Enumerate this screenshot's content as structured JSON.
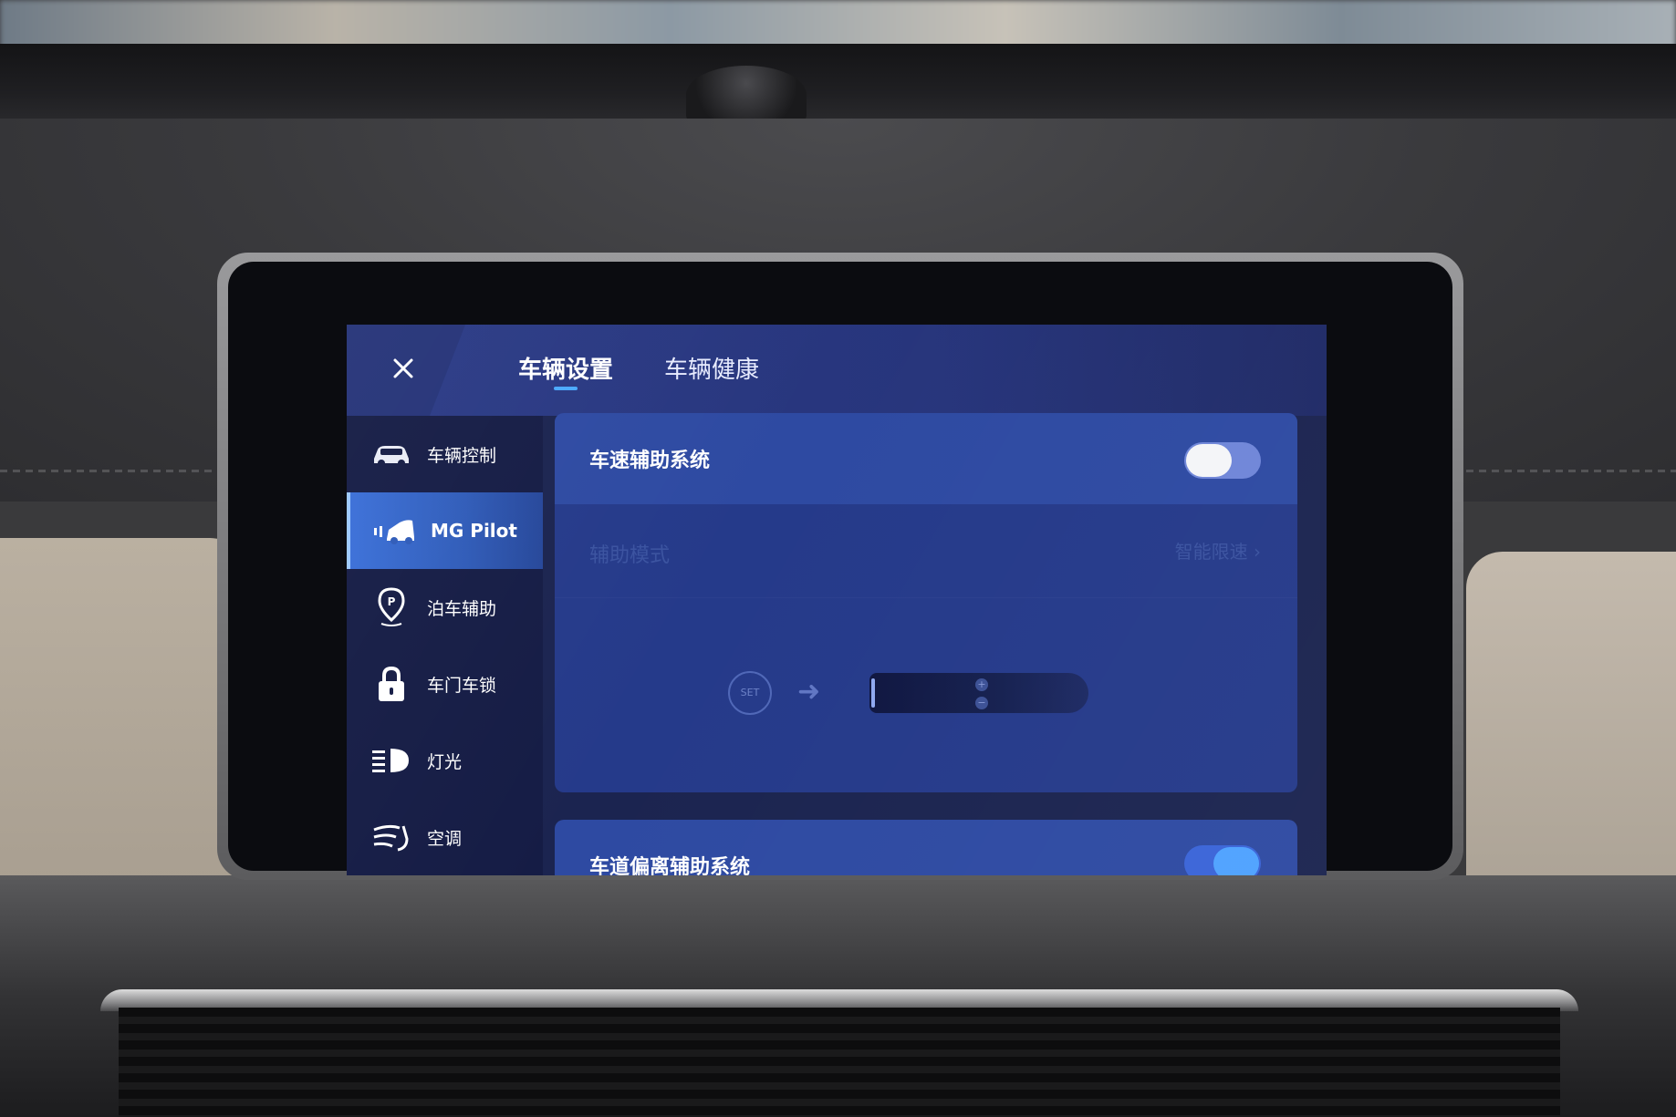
{
  "header": {
    "close_icon": "close-icon",
    "tabs": [
      {
        "label": "车辆设置",
        "active": true
      },
      {
        "label": "车辆健康",
        "active": false
      }
    ]
  },
  "sidebar": {
    "items": [
      {
        "label": "车辆控制",
        "icon": "car-icon",
        "active": false
      },
      {
        "label": "MG Pilot",
        "icon": "pilot-car-icon",
        "active": true
      },
      {
        "label": "泊车辅助",
        "icon": "parking-pin-icon",
        "active": false
      },
      {
        "label": "车门车锁",
        "icon": "lock-icon",
        "active": false
      },
      {
        "label": "灯光",
        "icon": "headlight-icon",
        "active": false
      },
      {
        "label": "空调",
        "icon": "air-conditioning-icon",
        "active": false
      }
    ]
  },
  "main": {
    "speed_assist": {
      "title": "车速辅助系统",
      "enabled": true
    },
    "assist_mode": {
      "title": "辅助模式",
      "value": "智能限速"
    },
    "illustration": {
      "set_label": "SET",
      "plus": "+",
      "minus": "−"
    },
    "lane_assist": {
      "title": "车道偏离辅助系统",
      "enabled": true
    }
  },
  "colors": {
    "accent": "#4aa9ff",
    "active_item": "#3a6fd8",
    "background": "#1b2450",
    "panel": "#253a8a"
  }
}
